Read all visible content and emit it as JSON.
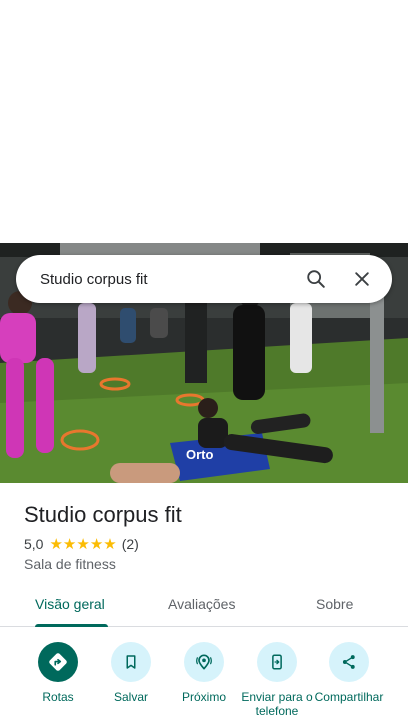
{
  "search": {
    "query": "Studio corpus fit"
  },
  "place": {
    "name": "Studio corpus fit",
    "rating": "5,0",
    "stars": 5,
    "review_count": "(2)",
    "category": "Sala de fitness"
  },
  "tabs": [
    {
      "label": "Visão geral",
      "active": true
    },
    {
      "label": "Avaliações",
      "active": false
    },
    {
      "label": "Sobre",
      "active": false
    }
  ],
  "actions": [
    {
      "label": "Rotas",
      "icon": "directions-icon"
    },
    {
      "label": "Salvar",
      "icon": "bookmark-icon"
    },
    {
      "label": "Próximo",
      "icon": "nearby-icon"
    },
    {
      "label": "Enviar para o telefone",
      "icon": "send-to-phone-icon"
    },
    {
      "label": "Compartilhar",
      "icon": "share-icon"
    }
  ],
  "photo": {
    "banner_text": "Orto"
  },
  "colors": {
    "accent": "#00695c",
    "action_bg": "#d6f3fb",
    "star": "#fbbc04"
  }
}
